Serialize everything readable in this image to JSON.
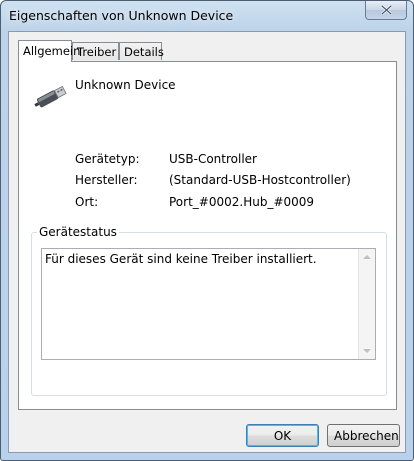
{
  "window": {
    "title": "Eigenschaften von Unknown Device"
  },
  "tabs": [
    {
      "label": "Allgemein",
      "active": true
    },
    {
      "label": "Treiber",
      "active": false
    },
    {
      "label": "Details",
      "active": false
    }
  ],
  "device": {
    "name": "Unknown Device",
    "icon": "usb-plug-icon",
    "properties": [
      {
        "label": "Gerätetyp:",
        "value": "USB-Controller"
      },
      {
        "label": "Hersteller:",
        "value": "(Standard-USB-Hostcontroller)"
      },
      {
        "label": "Ort:",
        "value": "Port_#0002.Hub_#0009"
      }
    ]
  },
  "status": {
    "legend": "Gerätestatus",
    "text": "Für dieses Gerät sind keine Treiber installiert."
  },
  "buttons": {
    "ok": "OK",
    "cancel": "Abbrechen"
  },
  "colors": {
    "title_bar": "#bcd3e9",
    "client_bg": "#f0f0f0",
    "default_button_border": "#3c7fb1"
  }
}
